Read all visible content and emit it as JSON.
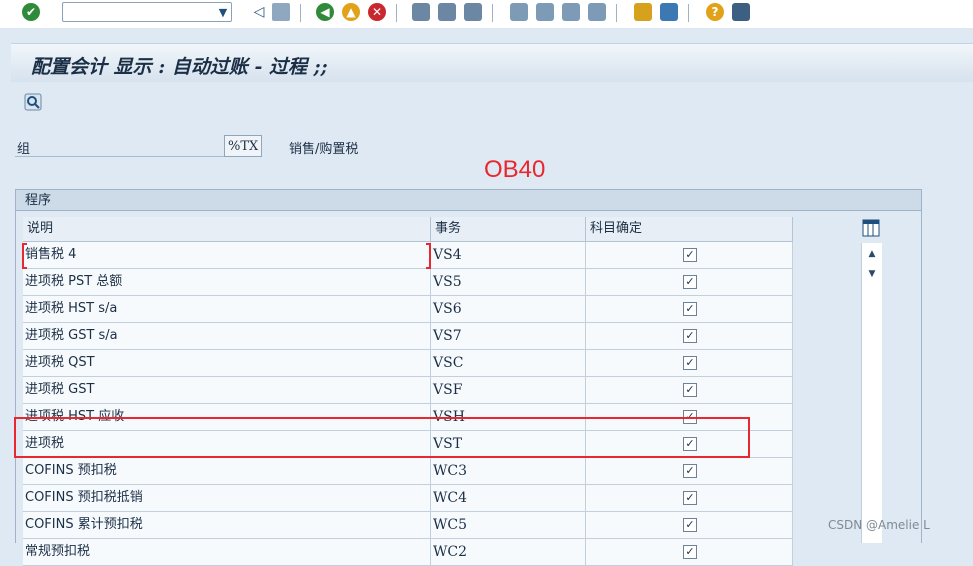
{
  "window": {
    "title": "配置会计 显示 : 自动过账 - 过程 ;;"
  },
  "toolbar": {
    "command_value": "",
    "icons": [
      "enter-icon",
      "back-icon",
      "save-icon",
      "back-nav-icon",
      "exit-icon",
      "cancel-icon",
      "print-icon",
      "find-icon",
      "find-next-icon",
      "first-page-icon",
      "prev-page-icon",
      "next-page-icon",
      "last-page-icon",
      "new-session-icon",
      "shortcut-icon",
      "help-icon",
      "customize-icon"
    ]
  },
  "group": {
    "label": "组",
    "value": "%TX",
    "description": "销售/购置税"
  },
  "annotation": {
    "text": "OB40"
  },
  "section": {
    "title": "程序"
  },
  "table": {
    "columns": [
      "说明",
      "事务",
      "科目确定"
    ],
    "rows": [
      {
        "desc": "销售税 4",
        "tx": "VS4",
        "checked": "✓"
      },
      {
        "desc": "进项税 PST 总额",
        "tx": "VS5",
        "checked": "✓"
      },
      {
        "desc": "进项税 HST s/a",
        "tx": "VS6",
        "checked": "✓"
      },
      {
        "desc": "进项税 GST s/a",
        "tx": "VS7",
        "checked": "✓"
      },
      {
        "desc": "进项税 QST",
        "tx": "VSC",
        "checked": "✓"
      },
      {
        "desc": "进项税 GST",
        "tx": "VSF",
        "checked": "✓"
      },
      {
        "desc": "进项税 HST 应收",
        "tx": "VSH",
        "checked": "✓"
      },
      {
        "desc": "进项税",
        "tx": "VST",
        "checked": "✓"
      },
      {
        "desc": "COFINS 预扣税",
        "tx": "WC3",
        "checked": "✓"
      },
      {
        "desc": "COFINS 预扣税抵销",
        "tx": "WC4",
        "checked": "✓"
      },
      {
        "desc": "COFINS 累计预扣税",
        "tx": "WC5",
        "checked": "✓"
      },
      {
        "desc": "常规预扣税",
        "tx": "WC2",
        "checked": "✓"
      }
    ]
  },
  "watermark": {
    "text": "CSDN @Amelie L"
  },
  "colors": {
    "accent": "#e8282e",
    "background": "#dfe9f3",
    "text": "#1b2f46"
  }
}
